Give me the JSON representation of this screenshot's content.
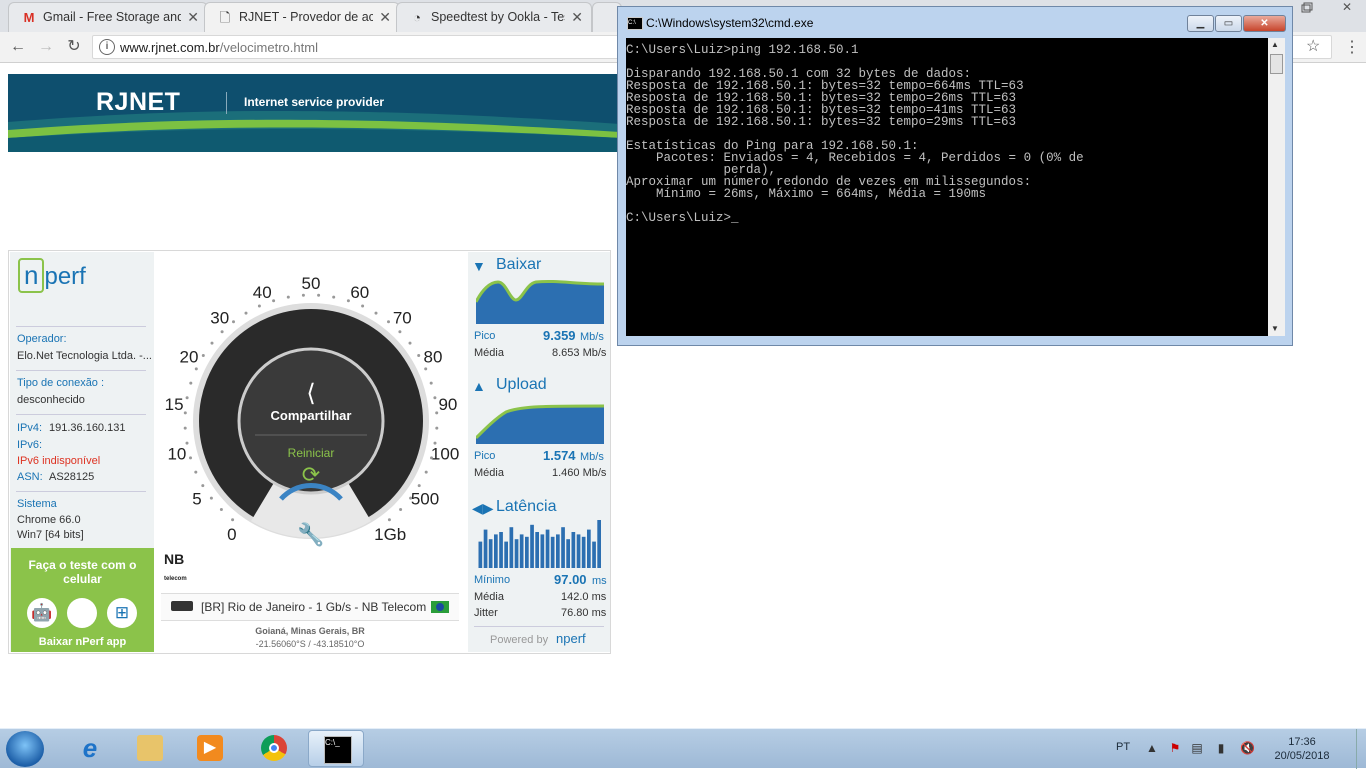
{
  "browser": {
    "tabs": [
      {
        "icon": "gmail-icon",
        "label": "Gmail - Free Storage and"
      },
      {
        "icon": "document-icon",
        "label": "RJNET - Provedor de aces"
      },
      {
        "icon": "speedometer-icon",
        "label": "Speedtest by Ookla - Tes"
      }
    ],
    "url_host": "www.rjnet.com.br",
    "url_path": "/velocimetro.html"
  },
  "banner": {
    "brand": "RJNET",
    "tagline": "Internet service provider"
  },
  "nperf": {
    "logo": "nperf",
    "operator_label": "Operador:",
    "operator_value": "Elo.Net Tecnologia Ltda. -...",
    "connection_label": "Tipo de conexão :",
    "connection_value": "desconhecido",
    "ipv4_label": "IPv4:",
    "ipv4_value": "191.36.160.131",
    "ipv6_label": "IPv6:",
    "ipv6_value": "IPv6 indisponível",
    "asn_label": "ASN:",
    "asn_value": "AS28125",
    "system_label": "Sistema",
    "system_browser": "Chrome 66.0",
    "system_os": "Win7 [64 bits]",
    "promo_title": "Faça o teste com o celular",
    "promo_download": "Baixar nPerf app",
    "gauge": {
      "ticks": [
        "0",
        "5",
        "10",
        "15",
        "20",
        "30",
        "40",
        "50",
        "60",
        "70",
        "80",
        "90",
        "100",
        "500",
        "1Gb"
      ],
      "share_label": "Compartilhar",
      "restart_label": "Reiniciar"
    },
    "isp_logo": "NB",
    "isp_logo_sub": "telecom",
    "server": "[BR] Rio de Janeiro - 1 Gb/s - NB Telecom",
    "location": "Goianá, Minas Gerais, BR",
    "coords": "-21.56060°S / -43.18510°O",
    "download": {
      "title": "Baixar",
      "peak_label": "Pico",
      "peak_value": "9.359",
      "peak_unit": "Mb/s",
      "avg_label": "Média",
      "avg_value": "8.653 Mb/s"
    },
    "upload": {
      "title": "Upload",
      "peak_label": "Pico",
      "peak_value": "1.574",
      "peak_unit": "Mb/s",
      "avg_label": "Média",
      "avg_value": "1.460 Mb/s"
    },
    "latency": {
      "title": "Latência",
      "min_label": "Mínimo",
      "min_value": "97.00",
      "min_unit": "ms",
      "avg_label": "Média",
      "avg_value": "142.0 ms",
      "jitter_label": "Jitter",
      "jitter_value": "76.80 ms",
      "bars": [
        0.55,
        0.8,
        0.6,
        0.7,
        0.75,
        0.55,
        0.85,
        0.6,
        0.7,
        0.65,
        0.9,
        0.75,
        0.7,
        0.8,
        0.65,
        0.7,
        0.85,
        0.6,
        0.75,
        0.7,
        0.65,
        0.8,
        0.55,
        1.0
      ]
    },
    "powered_by": "Powered by",
    "powered_logo": "nperf"
  },
  "cmd": {
    "title": "C:\\Windows\\system32\\cmd.exe",
    "output": "C:\\Users\\Luiz>ping 192.168.50.1\n\nDisparando 192.168.50.1 com 32 bytes de dados:\nResposta de 192.168.50.1: bytes=32 tempo=664ms TTL=63\nResposta de 192.168.50.1: bytes=32 tempo=26ms TTL=63\nResposta de 192.168.50.1: bytes=32 tempo=41ms TTL=63\nResposta de 192.168.50.1: bytes=32 tempo=29ms TTL=63\n\nEstatísticas do Ping para 192.168.50.1:\n    Pacotes: Enviados = 4, Recebidos = 4, Perdidos = 0 (0% de\n             perda),\nAproximar um número redondo de vezes em milissegundos:\n    Mínimo = 26ms, Máximo = 664ms, Média = 190ms\n\nC:\\Users\\Luiz>_"
  },
  "taskbar": {
    "apps": [
      "internet-explorer",
      "file-explorer",
      "media-player",
      "chrome",
      "cmd"
    ],
    "language": "PT",
    "time": "17:36",
    "date": "20/05/2018"
  },
  "colors": {
    "accent": "#1a74b4",
    "green": "#8bc34a",
    "banner": "#0e4f6e"
  }
}
